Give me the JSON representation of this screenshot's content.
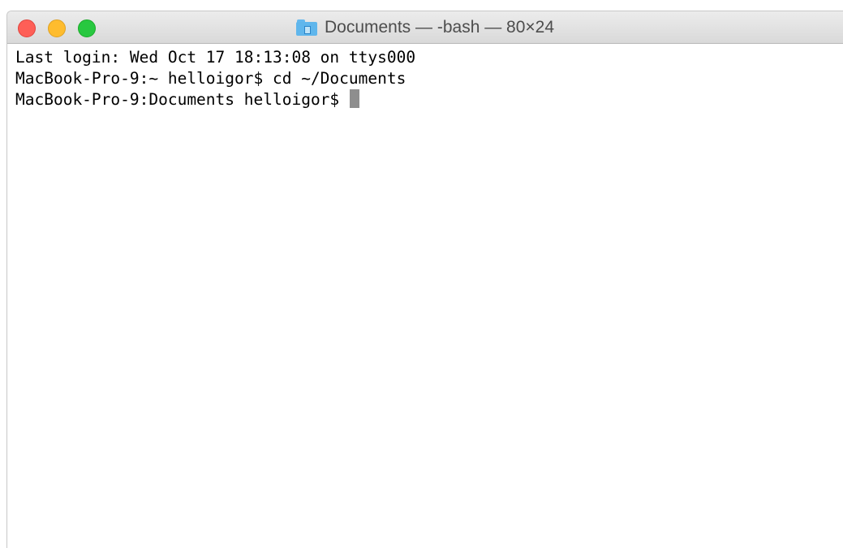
{
  "window": {
    "title": "Documents — -bash — 80×24",
    "title_icon": "folder-icon",
    "buttons": {
      "close_color": "#fe5f57",
      "minimize_color": "#febc2e",
      "zoom_color": "#28c840"
    }
  },
  "terminal": {
    "lines": [
      "Last login: Wed Oct 17 18:13:08 on ttys000",
      "MacBook-Pro-9:~ helloigor$ cd ~/Documents",
      "MacBook-Pro-9:Documents helloigor$ "
    ],
    "cursor": "block"
  }
}
